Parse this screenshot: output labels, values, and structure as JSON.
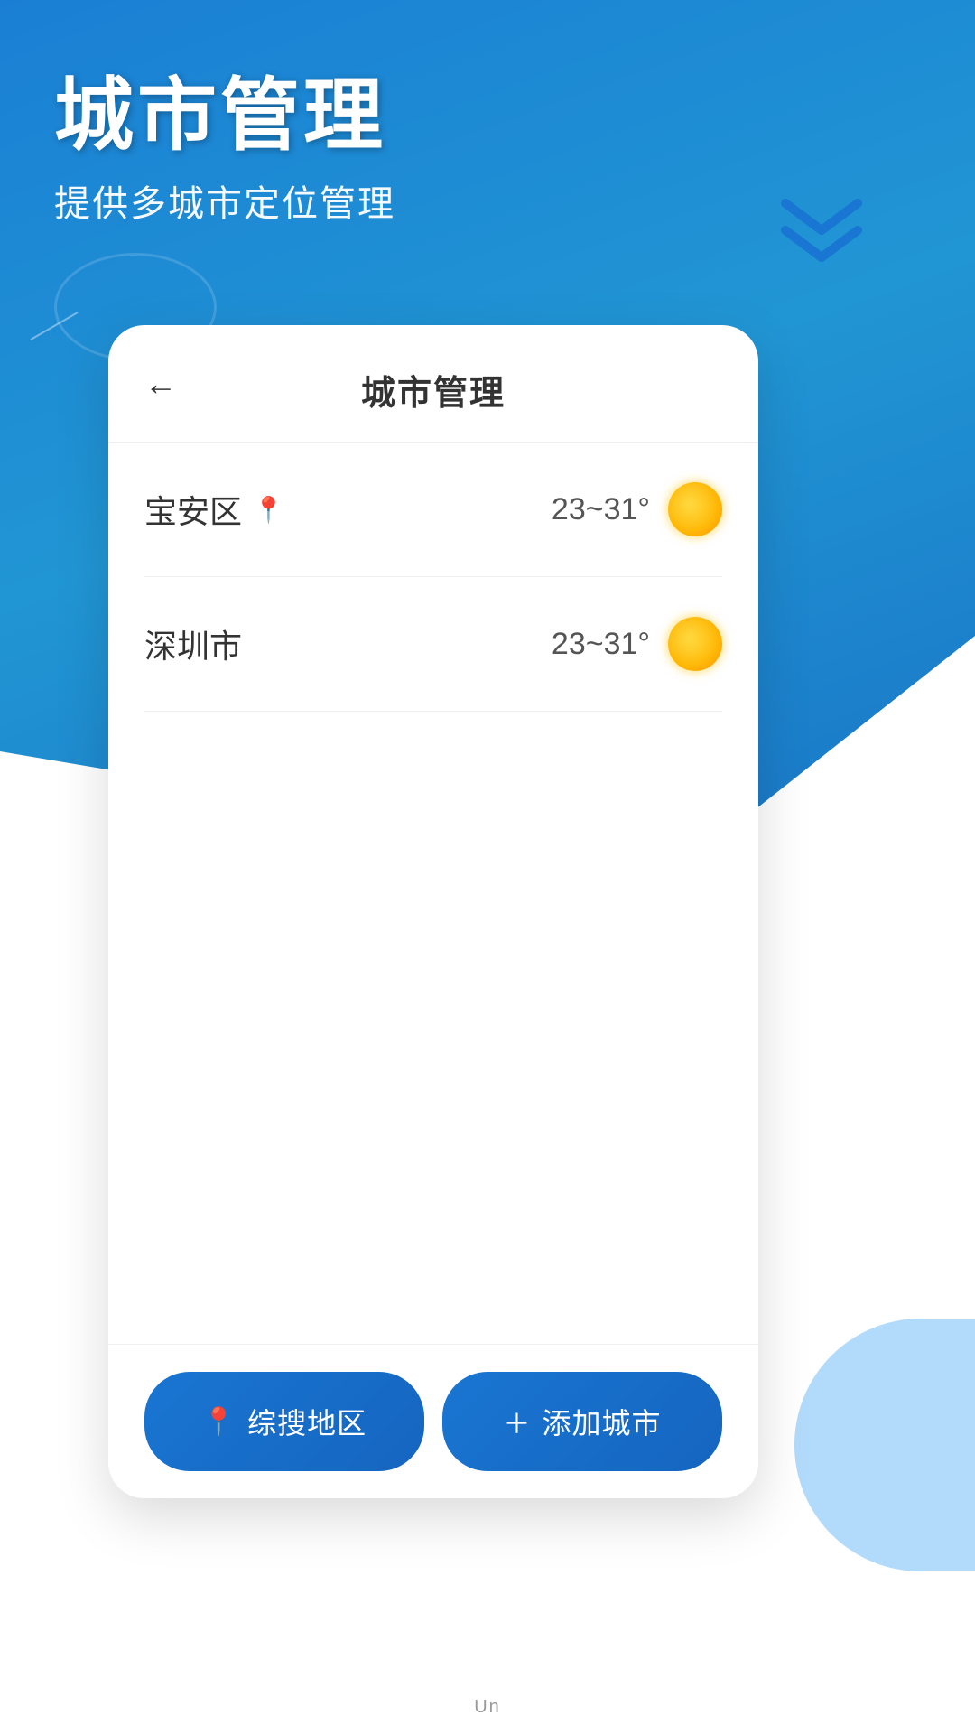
{
  "page": {
    "background_color": "#1976d2",
    "title": "城市管理",
    "subtitle": "提供多城市定位管理"
  },
  "header": {
    "back_label": "←",
    "title": "城市管理"
  },
  "cities": [
    {
      "name": "宝安区",
      "has_location_pin": true,
      "temp_range": "23~31°",
      "weather_icon": "sunny"
    },
    {
      "name": "深圳市",
      "has_location_pin": false,
      "temp_range": "23~31°",
      "weather_icon": "sunny"
    }
  ],
  "buttons": {
    "locate_label": "综搜地区",
    "add_label": "添加城市"
  },
  "bottom": {
    "text": "Un"
  }
}
